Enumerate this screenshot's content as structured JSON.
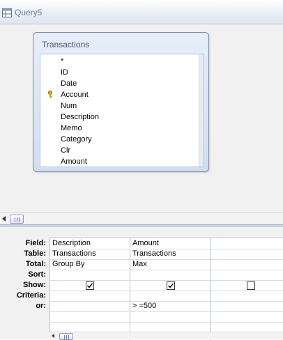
{
  "window": {
    "title": "Query5",
    "icon": "query-icon"
  },
  "table": {
    "title": "Transactions",
    "fields": [
      "*",
      "ID",
      "Date",
      "Account",
      "Num",
      "Description",
      "Memo",
      "Category",
      "Clr",
      "Amount"
    ],
    "primary_key_icon": "key-icon"
  },
  "grid": {
    "row_labels": {
      "field": "Field:",
      "table": "Table:",
      "total": "Total:",
      "sort": "Sort:",
      "show": "Show:",
      "criteria": "Criteria:",
      "or": "or:"
    },
    "columns": [
      {
        "field": "Description",
        "table": "Transactions",
        "total": "Group By",
        "sort": "",
        "show": true,
        "criteria": "",
        "or": ""
      },
      {
        "field": "Amount",
        "table": "Transactions",
        "total": "Max",
        "sort": "",
        "show": true,
        "criteria": "> =500",
        "or": ""
      },
      {
        "field": "",
        "table": "",
        "total": "",
        "sort": "",
        "show": false,
        "criteria": "",
        "or": ""
      }
    ]
  }
}
